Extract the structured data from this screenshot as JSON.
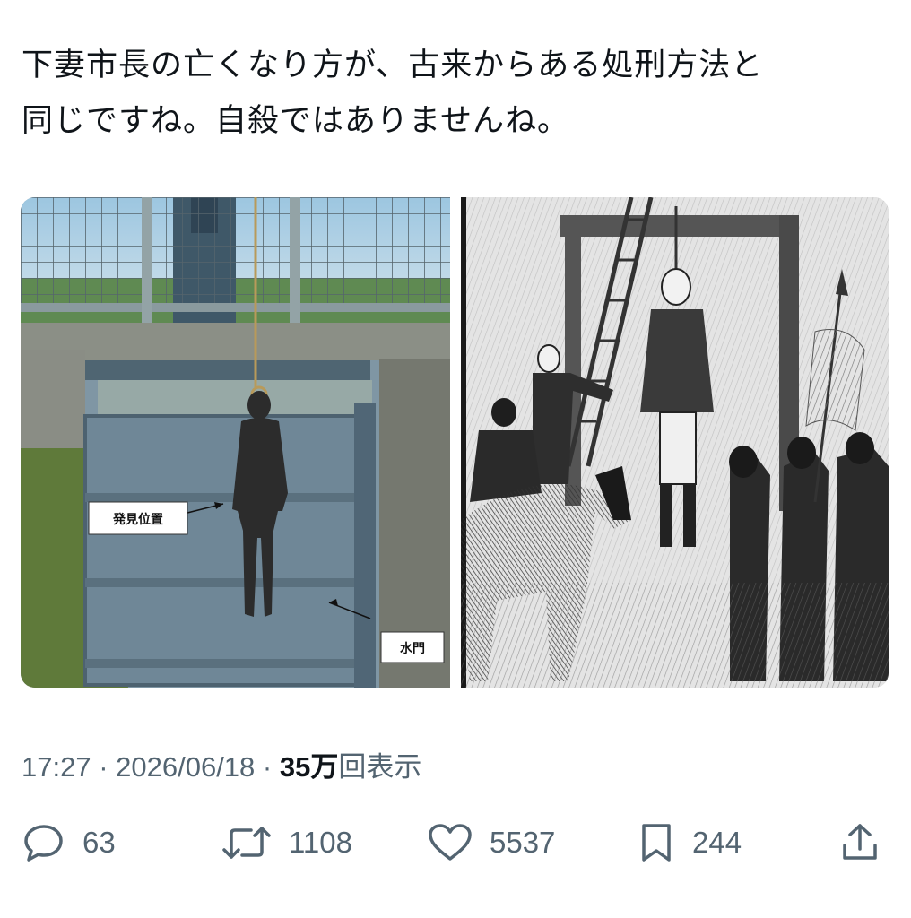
{
  "tweet": {
    "text_line1": "下妻市長の亡くなり方が、古来からある処刑方法と",
    "text_line2": "同じですね。自殺ではありませんね。"
  },
  "media": {
    "left_image": {
      "label_found": "発見位置",
      "label_gate": "水門"
    }
  },
  "meta": {
    "time": "17:27",
    "separator": " · ",
    "date": "2026/06/18",
    "views_number": "35万",
    "views_label": "回表示"
  },
  "actions": {
    "reply": {
      "count": "63",
      "icon": "reply-icon"
    },
    "retweet": {
      "count": "1108",
      "icon": "retweet-icon"
    },
    "like": {
      "count": "5537",
      "icon": "heart-icon"
    },
    "bookmark": {
      "count": "244",
      "icon": "bookmark-icon"
    },
    "share": {
      "icon": "share-icon"
    }
  },
  "colors": {
    "text": "#0f1419",
    "secondary": "#536471"
  }
}
